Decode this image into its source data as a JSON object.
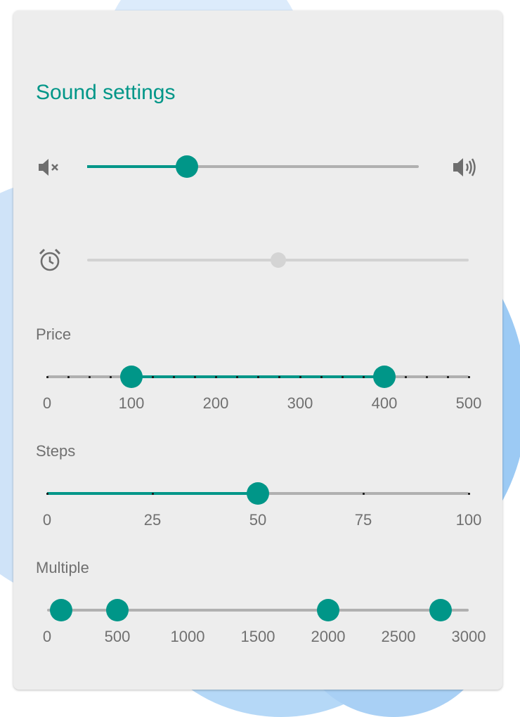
{
  "colors": {
    "accent": "#009688",
    "rail": "#b0b0b0",
    "card": "#ededed",
    "disabled": "#d4d4d4"
  },
  "title": "Sound settings",
  "volume": {
    "min_icon": "volume-mute-icon",
    "max_icon": "volume-up-icon",
    "value_fraction": 0.3
  },
  "alarm": {
    "icon": "alarm-clock-icon",
    "disabled": true,
    "value_fraction": 0.5
  },
  "price": {
    "label": "Price",
    "min": 0,
    "max": 500,
    "step": 25,
    "values": [
      100,
      400
    ],
    "tick_labels": [
      "0",
      "100",
      "200",
      "300",
      "400",
      "500"
    ]
  },
  "steps": {
    "label": "Steps",
    "min": 0,
    "max": 100,
    "step": 25,
    "value": 50,
    "tick_labels": [
      "0",
      "25",
      "50",
      "75",
      "100"
    ]
  },
  "multiple": {
    "label": "Multiple",
    "min": 0,
    "max": 3000,
    "values": [
      100,
      500,
      2000,
      2800
    ],
    "tick_labels": [
      "0",
      "500",
      "1000",
      "1500",
      "2000",
      "2500",
      "3000"
    ]
  }
}
